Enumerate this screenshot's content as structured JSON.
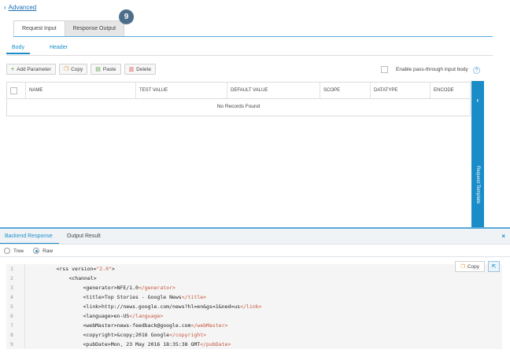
{
  "advanced": {
    "label": "Advanced"
  },
  "top_tabs": [
    {
      "label": "Request Input",
      "active": true
    },
    {
      "label": "Response Output",
      "active": false
    }
  ],
  "badge": "9",
  "sub_tabs": [
    {
      "label": "Body",
      "active": true
    },
    {
      "label": "Header",
      "active": false
    }
  ],
  "toolbar": {
    "add_label": "Add Parameter",
    "copy_label": "Copy",
    "paste_label": "Paste",
    "delete_label": "Delete"
  },
  "passthrough": {
    "label": "Enable pass-through input body",
    "help": "?"
  },
  "grid": {
    "columns": [
      "NAME",
      "TEST VALUE",
      "DEFAULT VALUE",
      "SCOPE",
      "DATATYPE",
      "ENCODE"
    ],
    "empty_text": "No Records Found"
  },
  "side_panel": {
    "label": "Request Template",
    "arrow": "‹"
  },
  "bottom_tabs": [
    {
      "label": "Backend Response",
      "active": true
    },
    {
      "label": "Output Result",
      "active": false
    }
  ],
  "close": "×",
  "view_modes": [
    {
      "label": "Tree",
      "selected": false
    },
    {
      "label": "Raw",
      "selected": true
    }
  ],
  "code_copy_label": "Copy",
  "code": {
    "line_numbers": [
      "1",
      "2",
      "3",
      "4",
      "5",
      "6",
      "7",
      "8",
      "9"
    ],
    "l1": {
      "open": "<rss ",
      "attr": "version=",
      "val": "\"2.0\"",
      "close": ">"
    },
    "l2": {
      "tag": "<channel>"
    },
    "l3": {
      "open": "<generator>",
      "text": "NFE/1.0",
      "close": "</generator>"
    },
    "l4": {
      "open": "<title>",
      "text": "Top Stories - Google News",
      "close": "</title>"
    },
    "l5": {
      "open": "<link>",
      "text": "http://news.google.com/news?hl=en&gs=1&ned=us",
      "close": "</link>"
    },
    "l6": {
      "open": "<language>",
      "text": "en-US",
      "close": "</language>"
    },
    "l7": {
      "open": "<webMaster>",
      "text": "news-feedback@google.com",
      "close": "</webMaster>"
    },
    "l8": {
      "open": "<copyright>",
      "text": "&copy;2016 Google",
      "close": "</copyright>"
    },
    "l9": {
      "open": "<pubDate>",
      "text": "Mon, 23 May 2016 18:35:38 GMT",
      "close": "</pubDate>"
    }
  }
}
